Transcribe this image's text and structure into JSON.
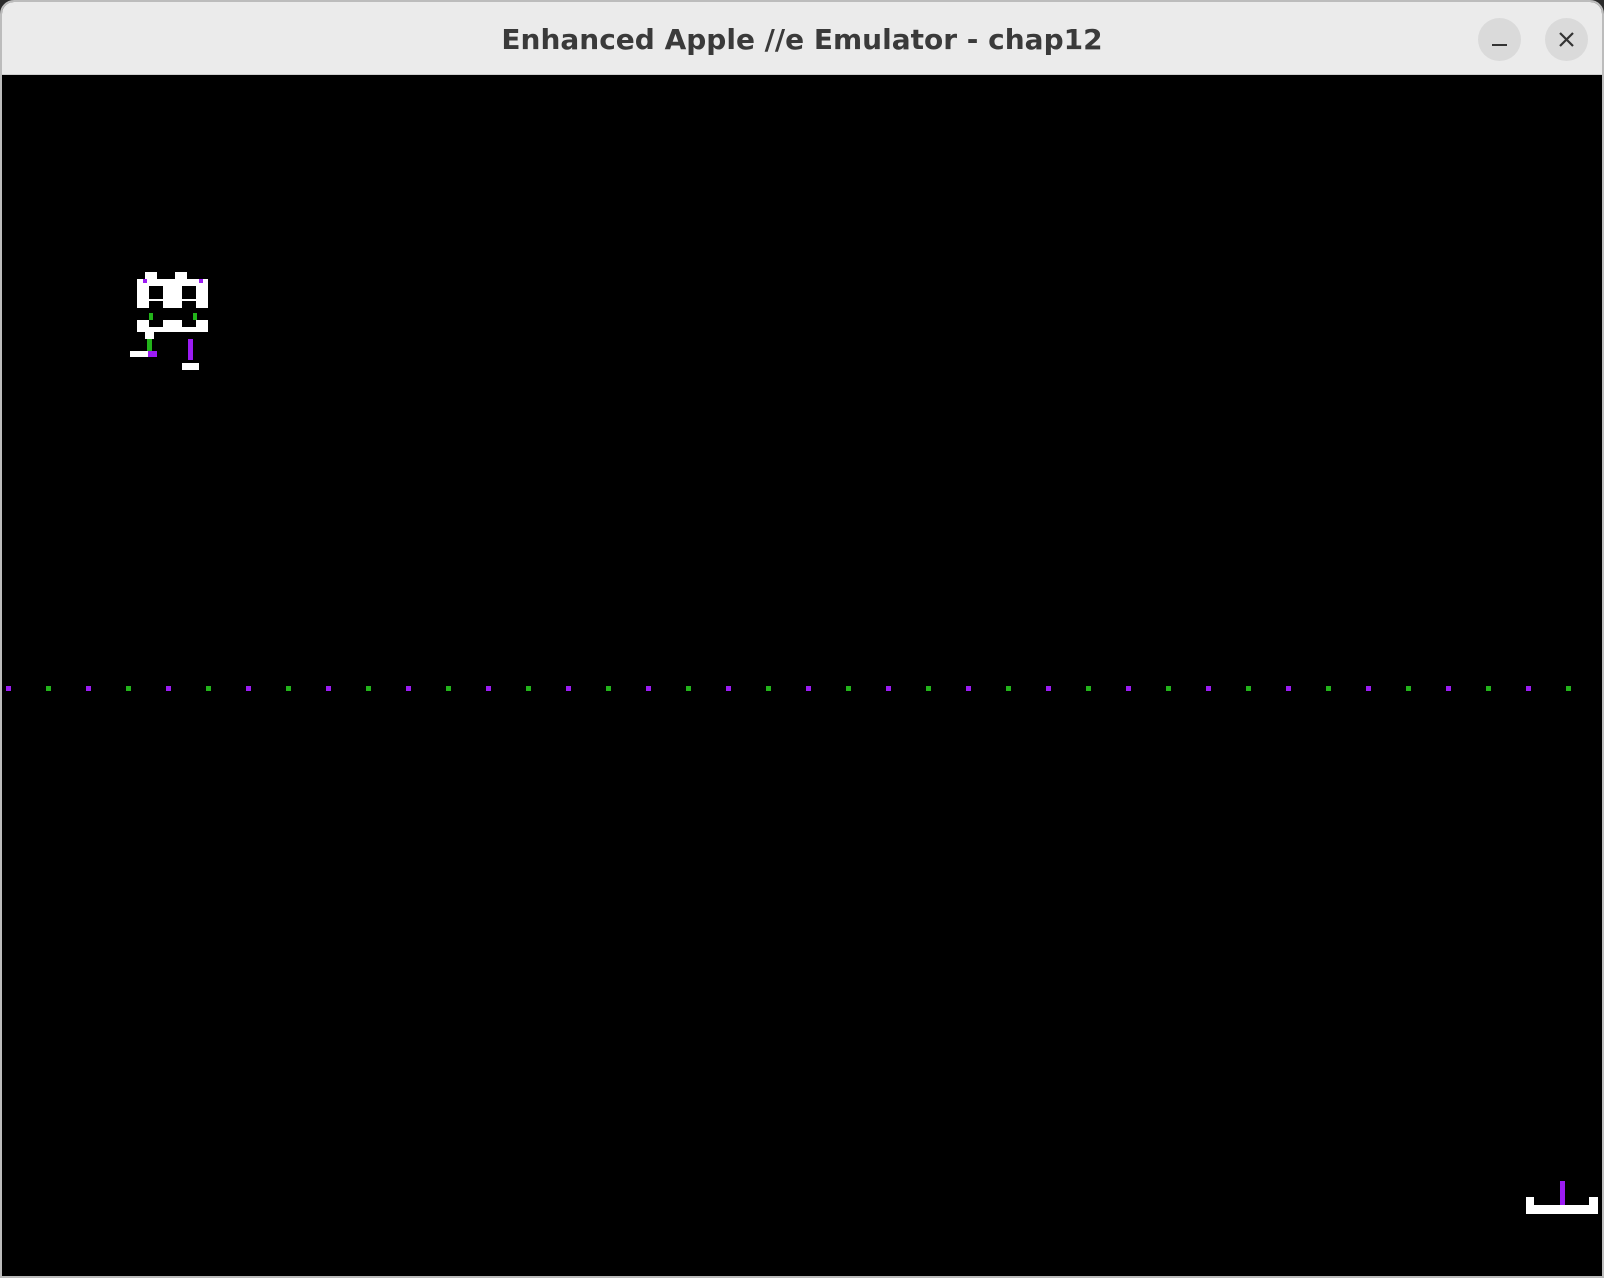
{
  "window": {
    "title": "Enhanced Apple //e Emulator - chap12"
  },
  "titlebar_buttons": [
    {
      "name": "minimize",
      "icon": "minimize-icon"
    },
    {
      "name": "close",
      "icon": "close-icon"
    }
  ],
  "screen": {
    "background": "#000000",
    "sprites": [
      {
        "name": "robot-sprite",
        "colors": [
          "#ffffff",
          "#9c1cf4",
          "#22b41a"
        ]
      },
      {
        "name": "player-ship",
        "colors": [
          "#ffffff",
          "#9c1cf4"
        ]
      }
    ],
    "ground_line": {
      "name": "dotted-ground-line",
      "colors": [
        "#9c1cf4",
        "#22b41a"
      ]
    }
  }
}
